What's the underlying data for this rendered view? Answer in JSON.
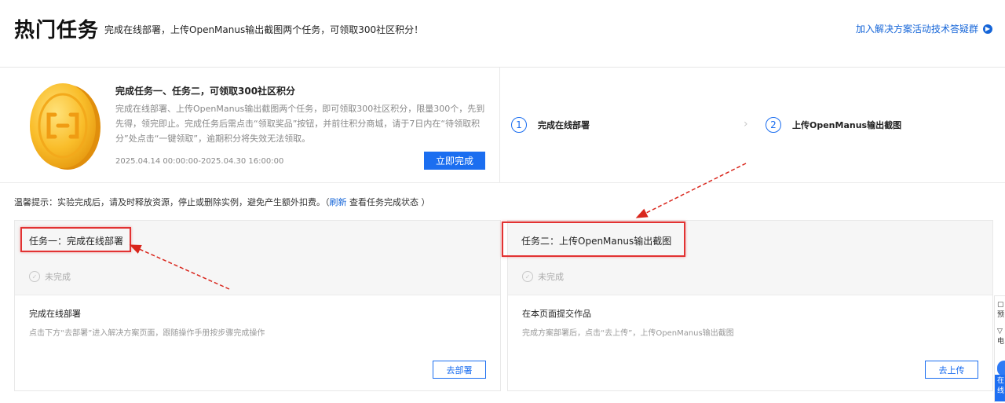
{
  "header": {
    "title": "热门任务",
    "description": "完成在线部署，上传OpenManus输出截图两个任务，可领取300社区积分！",
    "link_label": "加入解决方案活动技术答疑群"
  },
  "summary": {
    "title": "完成任务一、任务二，可领取300社区积分",
    "body": "完成在线部署、上传OpenManus输出截图两个任务，即可领取300社区积分，限量300个，先到先得，领完即止。完成任务后需点击“领取奖品”按钮，并前往积分商城，请于7日内在“待领取积分”处点击“一键领取”，逾期积分将失效无法领取。",
    "time_range": "2025.04.14 00:00:00-2025.04.30 16:00:00",
    "button_label": "立即完成"
  },
  "steps": [
    {
      "number": "1",
      "label": "完成在线部署"
    },
    {
      "number": "2",
      "label": "上传OpenManus输出截图"
    }
  ],
  "tip": {
    "prefix": "温馨提示：实验完成后，请及时释放资源，停止或删除实例，避免产生额外扣费。（",
    "refresh": "刷新",
    "suffix": "查看任务完成状态 ）"
  },
  "tasks": [
    {
      "title": "任务一：完成在线部署",
      "status": "未完成",
      "subtitle": "完成在线部署",
      "description": "点击下方“去部署”进入解决方案页面，跟随操作手册按步骤完成操作",
      "button_label": "去部署"
    },
    {
      "title": "任务二：上传OpenManus输出截图",
      "status": "未完成",
      "subtitle": "在本页面提交作品",
      "description": "完成方案部署后，点击“去上传”，上传OpenManus输出截图",
      "button_label": "去上传"
    }
  ],
  "dock": {
    "item1": "预",
    "item2": "电",
    "item3": "在",
    "item4": "线"
  },
  "colors": {
    "primary": "#1b6ef0",
    "link": "#1565d8",
    "highlight": "#e23232",
    "coin": "#f7b51a"
  }
}
